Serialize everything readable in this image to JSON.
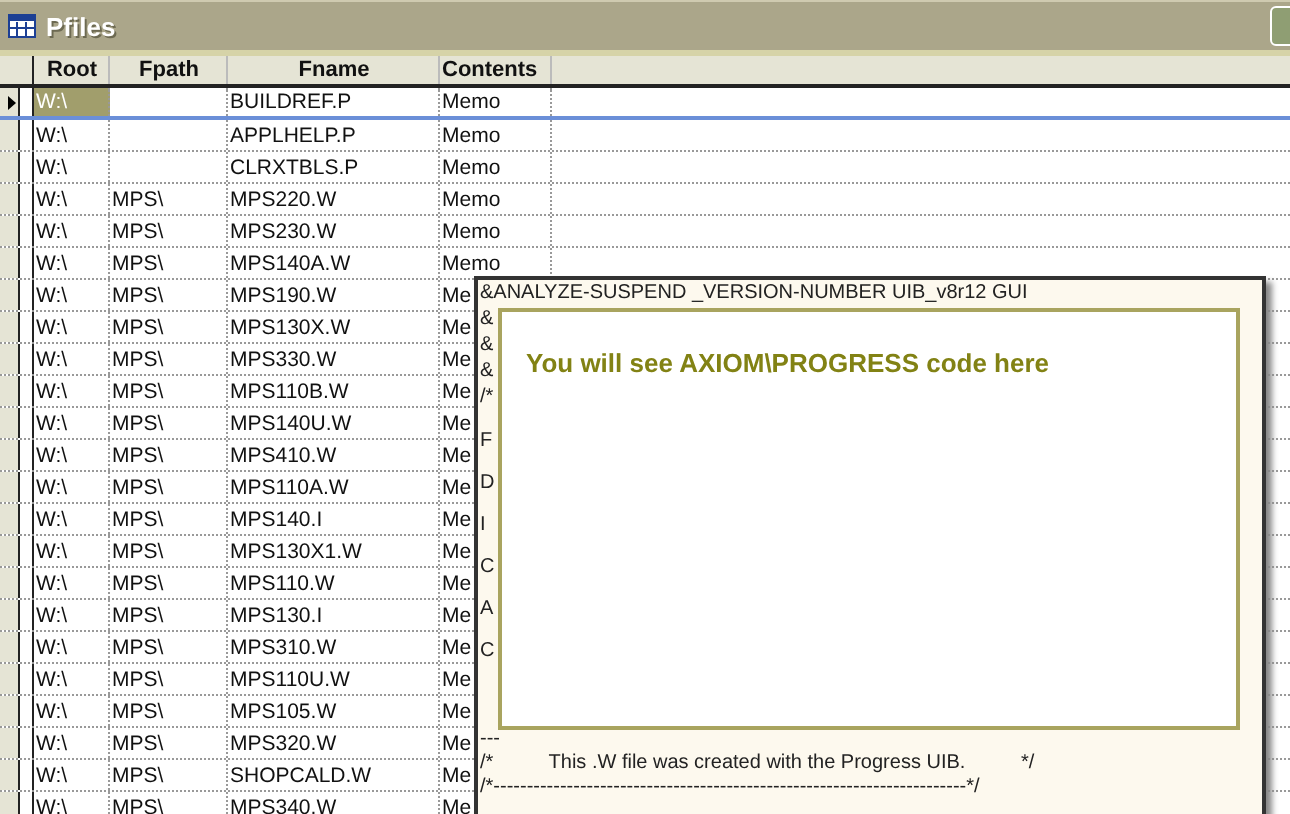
{
  "window": {
    "title": "Pfiles"
  },
  "table": {
    "columns": [
      "Root",
      "Fpath",
      "Fname",
      "Contents"
    ],
    "rows": [
      {
        "current": true,
        "cells": [
          "W:\\",
          "",
          "BUILDREF.P",
          "Memo"
        ]
      },
      {
        "current": false,
        "cells": [
          "W:\\",
          "",
          "APPLHELP.P",
          "Memo"
        ]
      },
      {
        "current": false,
        "cells": [
          "W:\\",
          "",
          "CLRXTBLS.P",
          "Memo"
        ]
      },
      {
        "current": false,
        "cells": [
          "W:\\",
          "MPS\\",
          "MPS220.W",
          "Memo"
        ]
      },
      {
        "current": false,
        "cells": [
          "W:\\",
          "MPS\\",
          "MPS230.W",
          "Memo"
        ]
      },
      {
        "current": false,
        "cells": [
          "W:\\",
          "MPS\\",
          "MPS140A.W",
          "Memo"
        ]
      },
      {
        "current": false,
        "cells": [
          "W:\\",
          "MPS\\",
          "MPS190.W",
          "Me"
        ]
      },
      {
        "current": false,
        "cells": [
          "W:\\",
          "MPS\\",
          "MPS130X.W",
          "Me"
        ]
      },
      {
        "current": false,
        "cells": [
          "W:\\",
          "MPS\\",
          "MPS330.W",
          "Me"
        ]
      },
      {
        "current": false,
        "cells": [
          "W:\\",
          "MPS\\",
          "MPS110B.W",
          "Me"
        ]
      },
      {
        "current": false,
        "cells": [
          "W:\\",
          "MPS\\",
          "MPS140U.W",
          "Me"
        ]
      },
      {
        "current": false,
        "cells": [
          "W:\\",
          "MPS\\",
          "MPS410.W",
          "Me"
        ]
      },
      {
        "current": false,
        "cells": [
          "W:\\",
          "MPS\\",
          "MPS110A.W",
          "Me"
        ]
      },
      {
        "current": false,
        "cells": [
          "W:\\",
          "MPS\\",
          "MPS140.I",
          "Me"
        ]
      },
      {
        "current": false,
        "cells": [
          "W:\\",
          "MPS\\",
          "MPS130X1.W",
          "Me"
        ]
      },
      {
        "current": false,
        "cells": [
          "W:\\",
          "MPS\\",
          "MPS110.W",
          "Me"
        ]
      },
      {
        "current": false,
        "cells": [
          "W:\\",
          "MPS\\",
          "MPS130.I",
          "Me"
        ]
      },
      {
        "current": false,
        "cells": [
          "W:\\",
          "MPS\\",
          "MPS310.W",
          "Me"
        ]
      },
      {
        "current": false,
        "cells": [
          "W:\\",
          "MPS\\",
          "MPS110U.W",
          "Me"
        ]
      },
      {
        "current": false,
        "cells": [
          "W:\\",
          "MPS\\",
          "MPS105.W",
          "Me"
        ]
      },
      {
        "current": false,
        "cells": [
          "W:\\",
          "MPS\\",
          "MPS320.W",
          "Me"
        ]
      },
      {
        "current": false,
        "cells": [
          "W:\\",
          "MPS\\",
          "SHOPCALD.W",
          "Me"
        ]
      },
      {
        "current": false,
        "cells": [
          "W:\\",
          "MPS\\",
          "MPS340.W",
          "Me"
        ]
      }
    ]
  },
  "memo": {
    "header_lines": [
      "&ANALYZE-SUSPEND _VERSION-NUMBER UIB_v8r12 GUI",
      "&",
      "&",
      "&",
      "/*"
    ],
    "body_lines": [
      "F",
      "D",
      "I",
      "C",
      "A",
      "C"
    ],
    "footer_lines": [
      "---",
      "/*          This .W file was created with the Progress UIB.          */",
      "/*-----------------------------------------------------------------------*/"
    ],
    "callout": "You will see AXIOM\\PROGRESS code here"
  }
}
